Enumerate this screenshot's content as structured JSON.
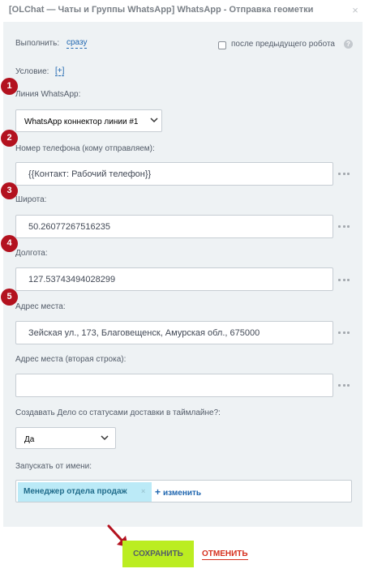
{
  "header": {
    "title": "[OLChat — Чаты и Группы WhatsApp] WhatsApp - Отправка геометки",
    "close_icon": "×"
  },
  "execute": {
    "label": "Выполнить:",
    "value": "сразу",
    "after_previous_label": "после предыдущего робота",
    "after_previous_checked": false,
    "help_icon": "?"
  },
  "condition": {
    "label": "Условие:",
    "add_link": "[+]"
  },
  "markers": [
    "1",
    "2",
    "3",
    "4",
    "5"
  ],
  "fields": {
    "line": {
      "label": "Линия WhatsApp:",
      "value": "WhatsApp коннектор линии #1"
    },
    "phone": {
      "label": "Номер телефона (кому отправляем):",
      "value": "{{Контакт: Рабочий телефон}}"
    },
    "latitude": {
      "label": "Широта:",
      "value": "50.26077267516235"
    },
    "longitude": {
      "label": "Долгота:",
      "value": "127.53743494028299"
    },
    "address": {
      "label": "Адрес места:",
      "value": "Зейская ул., 173, Благовещенск, Амурская обл., 675000"
    },
    "address2": {
      "label": "Адрес места (вторая строка):",
      "value": ""
    },
    "create_task": {
      "label": "Создавать Дело со статусами доставки в таймлайне?:",
      "value": "Да"
    },
    "run_as": {
      "label": "Запускать от имени:",
      "user": "Менеджер отдела продаж",
      "remove_icon": "×",
      "change_plus": "+",
      "change_link": "изменить"
    }
  },
  "footer": {
    "save_label": "СОХРАНИТЬ",
    "cancel_label": "ОТМЕНИТЬ"
  },
  "colors": {
    "accent_link": "#2067b0",
    "save_button": "#bbed21",
    "cancel_text": "#d6301e",
    "marker": "#b3121f",
    "panel_bg": "#eef2f4",
    "user_tag_bg": "#bbeaf7"
  }
}
